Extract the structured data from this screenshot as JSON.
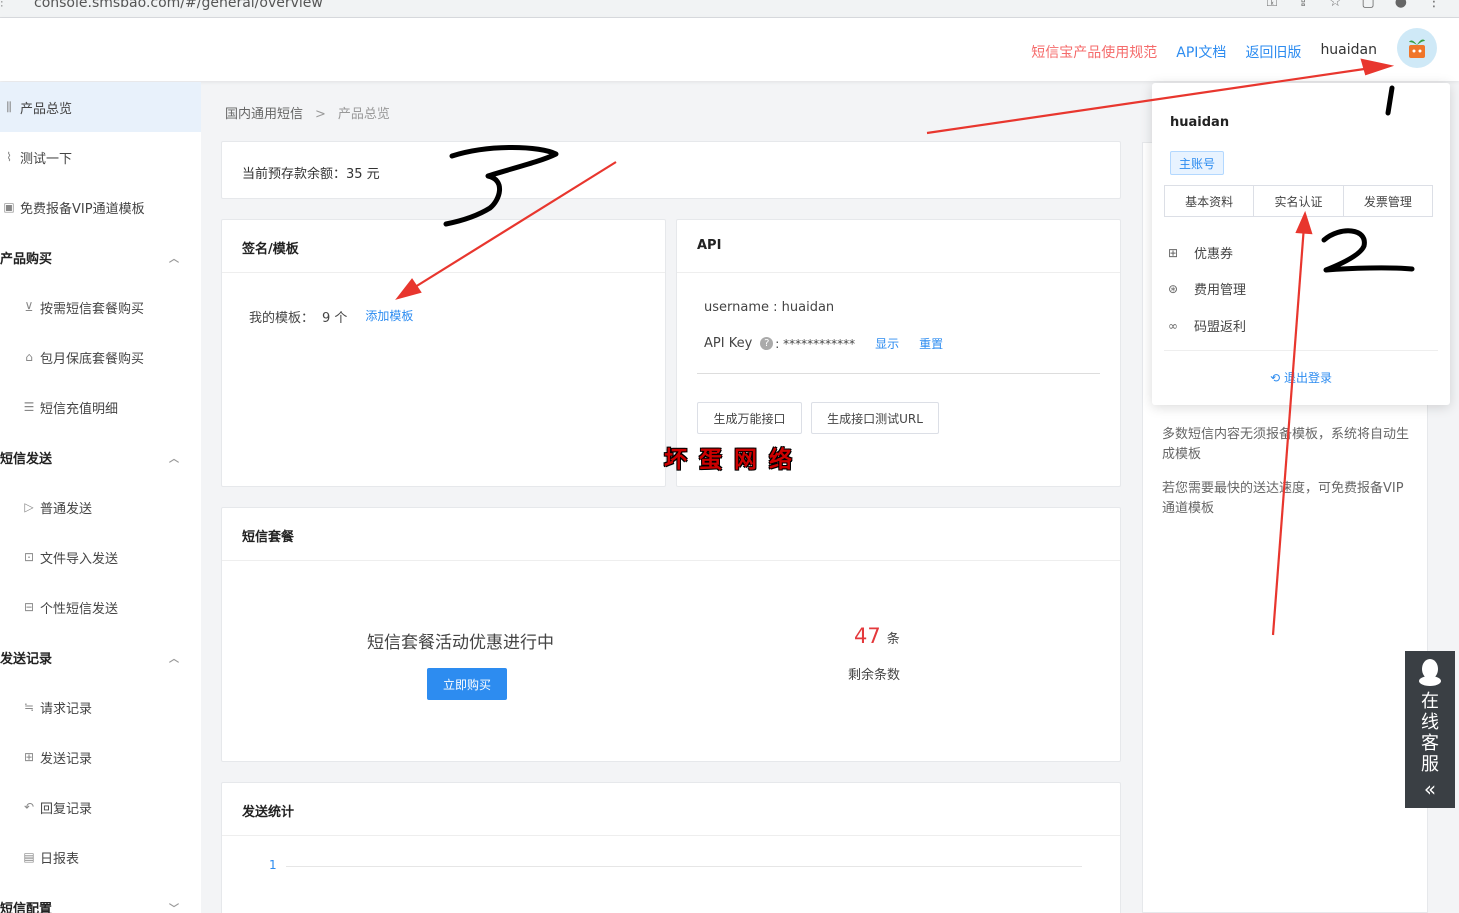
{
  "browser": {
    "url": "console.smsbao.com/#/general/overview"
  },
  "header": {
    "links": {
      "rules": "短信宝产品使用规范",
      "api_docs": "API文档",
      "old_version": "返回旧版",
      "username": "huaidan"
    }
  },
  "sidebar": {
    "items": [
      {
        "label": "产品总览",
        "icon": "bar-chart-icon"
      },
      {
        "label": "测试一下",
        "icon": "pulse-icon"
      },
      {
        "label": "免费报备VIP通道模板",
        "icon": "template-icon"
      }
    ],
    "groups": [
      {
        "label": "产品购买",
        "items": [
          "按需短信套餐购买",
          "包月保底套餐购买",
          "短信充值明细"
        ]
      },
      {
        "label": "短信发送",
        "items": [
          "普通发送",
          "文件导入发送",
          "个性短信发送"
        ]
      },
      {
        "label": "发送记录",
        "items": [
          "请求记录",
          "发送记录",
          "回复记录",
          "日报表"
        ]
      },
      {
        "label": "短信配置"
      }
    ]
  },
  "breadcrumb": {
    "root": "国内通用短信",
    "separator": ">",
    "current": "产品总览"
  },
  "balance": {
    "text": "当前预存款余额：35 元"
  },
  "signature": {
    "title": "签名/模板",
    "my_templates_label": "我的模板：",
    "my_templates_count": "9 个",
    "add_template": "添加模板"
  },
  "api": {
    "title": "API",
    "username_text": "username : huaidan",
    "api_key_label": "API Key",
    "api_key_value": ": ************",
    "show": "显示",
    "reset": "重置",
    "btn_universal": "生成万能接口",
    "btn_test_url": "生成接口测试URL"
  },
  "package": {
    "title": "短信套餐",
    "promo": "短信套餐活动优惠进行中",
    "buy_now": "立即购买",
    "remaining_count": "47",
    "remaining_unit": "条",
    "remaining_label": "剩余条数"
  },
  "stats": {
    "title": "发送统计",
    "y_tick": "1"
  },
  "dropdown": {
    "username": "huaidan",
    "tag": "主账号",
    "tabs": [
      "基本资料",
      "实名认证",
      "发票管理"
    ],
    "items": [
      {
        "label": "优惠券",
        "icon": "coupon-icon"
      },
      {
        "label": "费用管理",
        "icon": "fee-icon"
      },
      {
        "label": "码盟返利",
        "icon": "link-icon"
      }
    ],
    "logout": "退出登录"
  },
  "right_panel": {
    "p1": "多数短信内容无须报备模板，系统将自动生成模板",
    "p2": "若您需要最快的送达速度，可免费报备VIP 通道模板"
  },
  "customer_service": {
    "label": "在线客服"
  },
  "watermark": "坏蛋网络",
  "annotations": [
    "1",
    "2",
    "3"
  ],
  "colors": {
    "primary": "#2d8cf0",
    "danger": "#f56c6c",
    "count_red": "#e4393c",
    "annotation": "#e8362e"
  }
}
